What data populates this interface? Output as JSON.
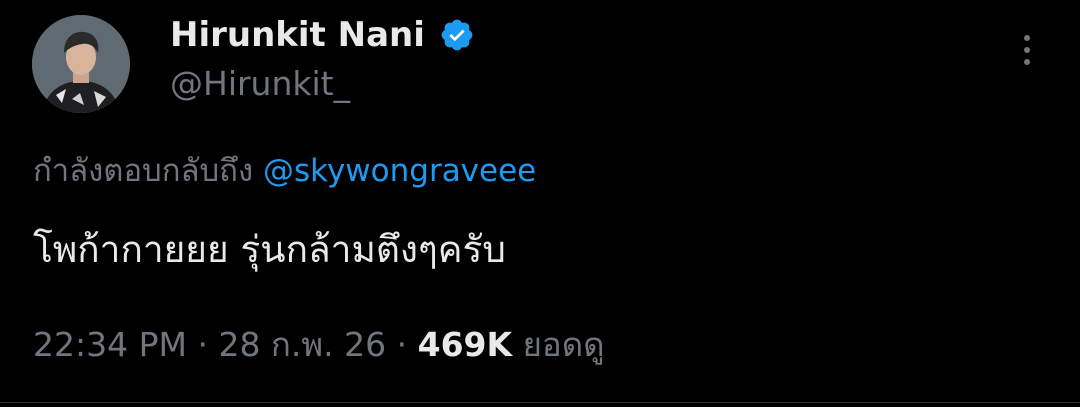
{
  "author": {
    "display_name": "Hirunkit Nani",
    "handle": "@Hirunkit_",
    "verified": true,
    "avatar_icon": "avatar-photo"
  },
  "reply": {
    "prefix": "กำลังตอบกลับถึง",
    "mention": "@skywongraveee"
  },
  "tweet": {
    "text": "โพก้ากายยย รุ่นกล้ามตึงๆครับ"
  },
  "meta": {
    "time": "22:34 PM",
    "sep1": " · ",
    "date": "28 ก.พ. 26",
    "sep2": " · ",
    "views_count": "469K",
    "views_label": "ยอดดู"
  },
  "colors": {
    "background": "#000000",
    "primary_text": "#e7e9ea",
    "secondary_text": "#71767b",
    "accent": "#1d9bf0"
  },
  "icons": {
    "verified": "verified-badge-icon",
    "more": "more-options-icon"
  }
}
